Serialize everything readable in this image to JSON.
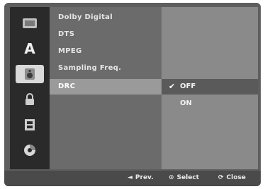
{
  "sidebar": {
    "items": [
      {
        "icon": "disc-icon",
        "active": false
      },
      {
        "icon": "language-icon",
        "label": "A",
        "active": false
      },
      {
        "icon": "speaker-icon",
        "active": true
      },
      {
        "icon": "lock-icon",
        "active": false
      },
      {
        "icon": "film-icon",
        "active": false
      },
      {
        "icon": "other-disc-icon",
        "active": false
      }
    ]
  },
  "menu": {
    "items": [
      {
        "label": "Dolby Digital",
        "selected": false
      },
      {
        "label": "DTS",
        "selected": false
      },
      {
        "label": "MPEG",
        "selected": false
      },
      {
        "label": "Sampling Freq.",
        "selected": false
      },
      {
        "label": "DRC",
        "selected": true
      }
    ]
  },
  "options": {
    "items": [
      {
        "label": "OFF",
        "selected": true
      },
      {
        "label": "ON",
        "selected": false
      }
    ]
  },
  "footer": {
    "prev": {
      "symbol": "◄",
      "label": "Prev."
    },
    "select": {
      "symbol": "⊙",
      "label": "Select"
    },
    "close": {
      "symbol": "⟳",
      "label": "Close"
    }
  }
}
